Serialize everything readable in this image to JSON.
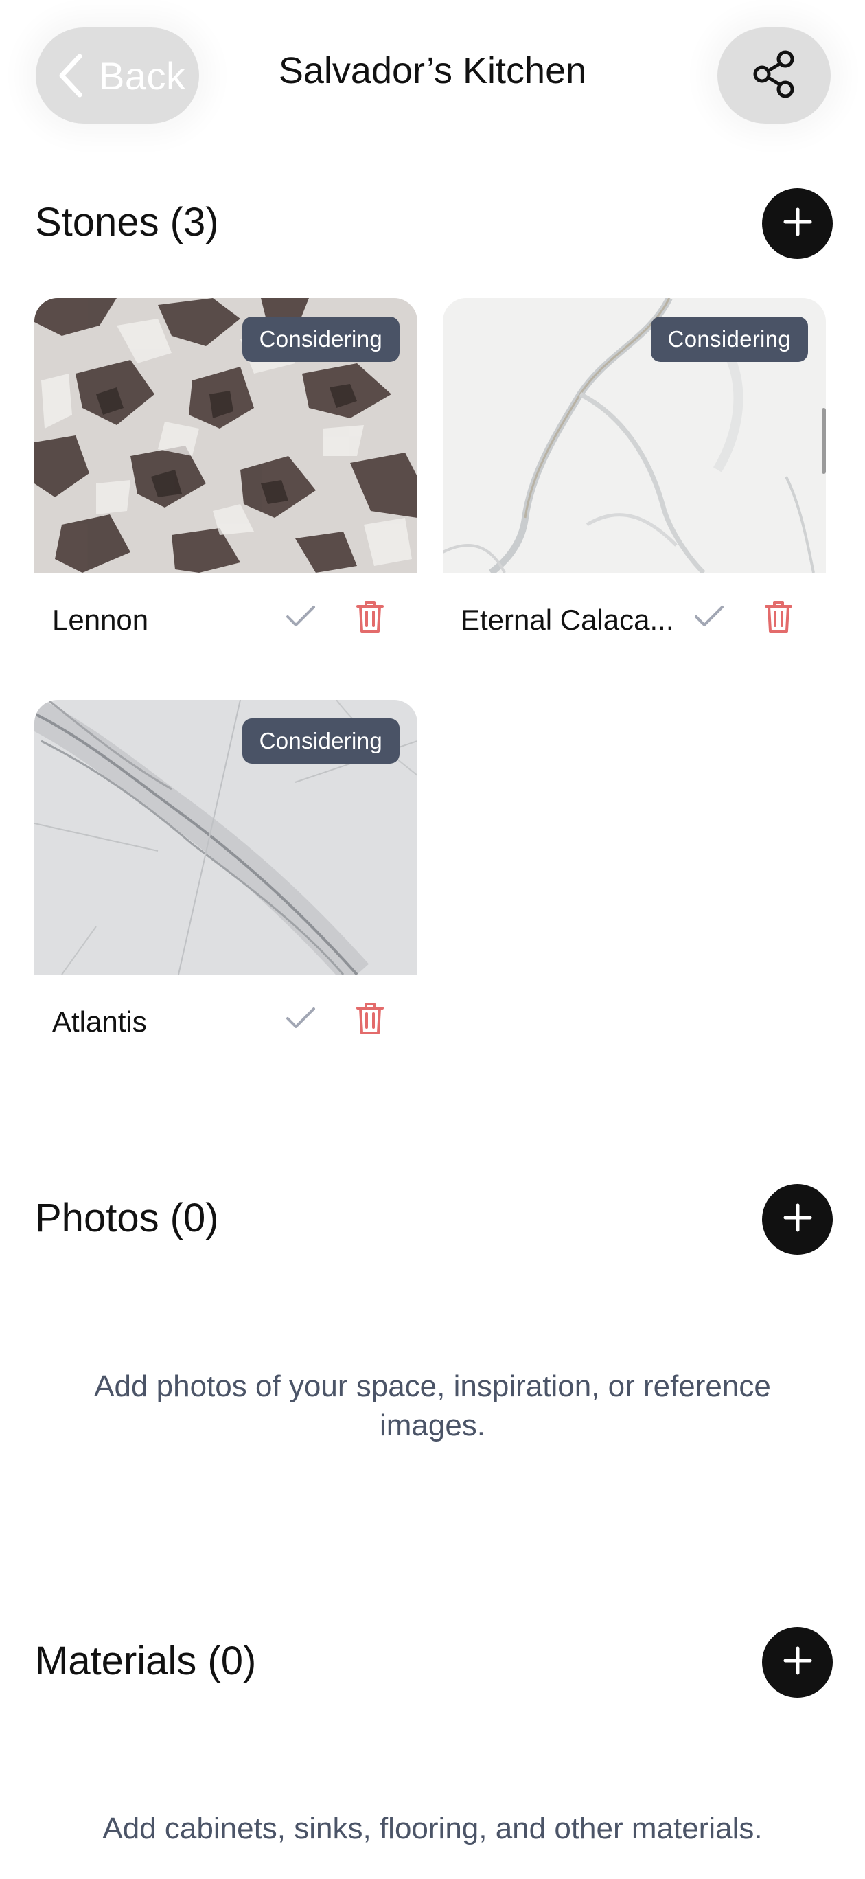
{
  "header": {
    "back_label": "Back",
    "title": "Salvador’s Kitchen"
  },
  "sections": {
    "stones": {
      "title": "Stones (3)",
      "items": [
        {
          "name": "Lennon",
          "status": "Considering"
        },
        {
          "name": "Eternal Calaca...",
          "status": "Considering"
        },
        {
          "name": "Atlantis",
          "status": "Considering"
        }
      ]
    },
    "photos": {
      "title": "Photos (0)",
      "empty_text": "Add photos of your space, inspiration, or reference images."
    },
    "materials": {
      "title": "Materials (0)",
      "empty_text": "Add cabinets, sinks, flooring, and other materials."
    }
  },
  "icons": {
    "back": "chevron-left-icon",
    "share": "share-icon",
    "add": "plus-icon",
    "select": "check-icon",
    "delete": "trash-icon"
  },
  "colors": {
    "badge": "#4a5366",
    "delete": "#e36b6b",
    "check": "#a2a7b4",
    "add_button": "#111111",
    "muted_text": "#4b5467"
  }
}
